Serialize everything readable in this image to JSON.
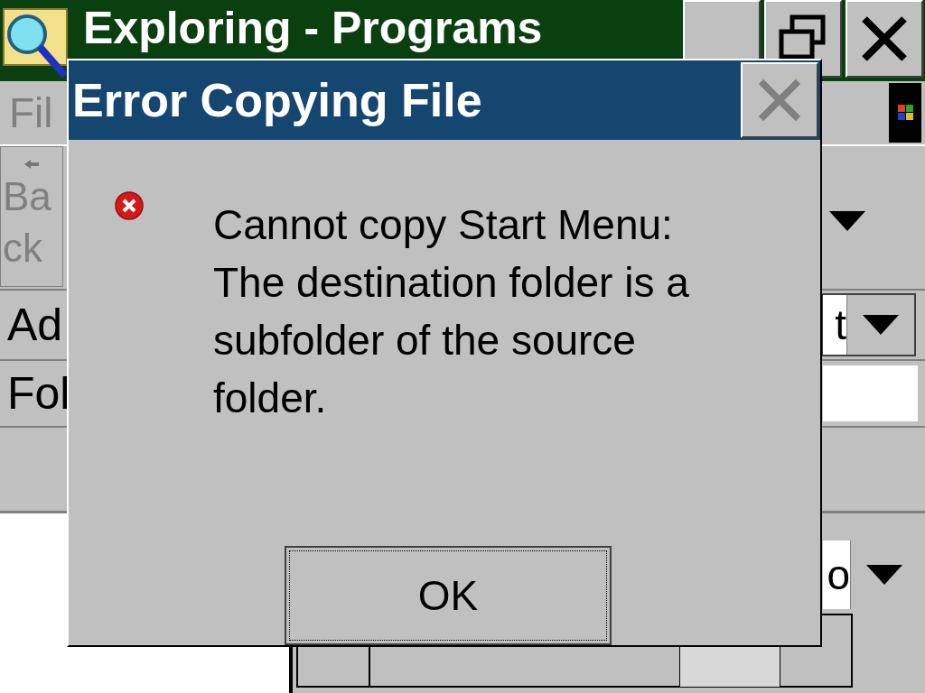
{
  "background_window": {
    "title": "Exploring - Programs",
    "menu_label": "Fil",
    "back_button": "Back",
    "address_label": "Ad",
    "address_value": "t",
    "folders_label": "Fol",
    "view_value": "o"
  },
  "dialog": {
    "title": "Error Copying File",
    "close_disabled": true,
    "message": "Cannot copy Start Menu:\nThe destination folder is a\nsubfolder of the source\nfolder.",
    "buttons": [
      {
        "label": "OK",
        "focused": true
      }
    ]
  }
}
